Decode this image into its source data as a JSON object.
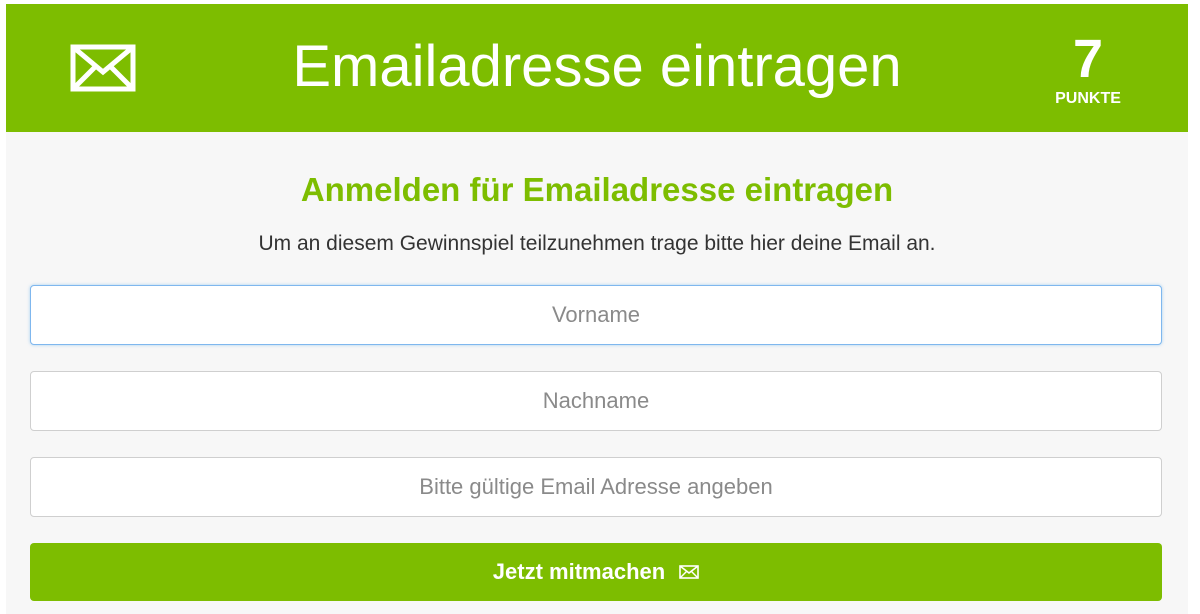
{
  "header": {
    "icon": "envelope-icon",
    "title": "Emailadresse eintragen",
    "points_value": "7",
    "points_label": "PUNKTE"
  },
  "form": {
    "heading": "Anmelden für Emailadresse eintragen",
    "intro": "Um an diesem Gewinnspiel teilzunehmen trage bitte hier deine Email an.",
    "fields": [
      {
        "placeholder": "Vorname",
        "value": ""
      },
      {
        "placeholder": "Nachname",
        "value": ""
      },
      {
        "placeholder": "Bitte gültige Email Adresse angeben",
        "value": ""
      }
    ],
    "submit_label": "Jetzt mitmachen",
    "submit_icon": "envelope-icon"
  },
  "colors": {
    "brand_green": "#7dbd00",
    "background": "#f7f7f7",
    "focus_border": "#7fb7ee"
  }
}
